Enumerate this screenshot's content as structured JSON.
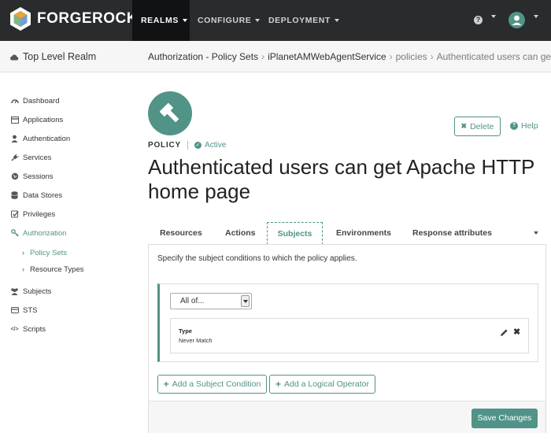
{
  "brand": {
    "name": "FORGEROCK",
    "accent": "#519387",
    "navbar_bg": "#292b2c"
  },
  "nav": {
    "items": [
      {
        "label": "REALMS",
        "active": true
      },
      {
        "label": "CONFIGURE"
      },
      {
        "label": "DEPLOYMENT"
      }
    ],
    "help_icon": "question-circle-icon",
    "help_glyph": "?",
    "user_icon": "avatar-icon"
  },
  "realm": {
    "label": "Top Level Realm",
    "icon": "cloud-icon"
  },
  "breadcrumb": {
    "items": [
      "Authorization - Policy Sets",
      "iPlanetAMWebAgentService",
      "policies",
      "Authenticated users can get Apache HTTP home page"
    ],
    "separator": "›"
  },
  "sidebar": {
    "items": [
      {
        "label": "Dashboard",
        "icon": "dashboard-icon"
      },
      {
        "label": "Applications",
        "icon": "applications-icon"
      },
      {
        "label": "Authentication",
        "icon": "user-icon"
      },
      {
        "label": "Services",
        "icon": "plug-icon"
      },
      {
        "label": "Sessions",
        "icon": "globe-icon"
      },
      {
        "label": "Data Stores",
        "icon": "database-icon"
      },
      {
        "label": "Privileges",
        "icon": "check-square-icon"
      },
      {
        "label": "Authorization",
        "icon": "key-icon",
        "active": true
      },
      {
        "label": "Subjects",
        "icon": "users-icon"
      },
      {
        "label": "STS",
        "icon": "card-icon"
      },
      {
        "label": "Scripts",
        "icon": "code-icon"
      }
    ],
    "subitems": [
      {
        "label": "Policy Sets",
        "active": true
      },
      {
        "label": "Resource Types"
      }
    ],
    "chevron": "›",
    "script_glyph": "</>"
  },
  "policy": {
    "label": "POLICY",
    "status": "Active",
    "status_glyph": "✓",
    "title": "Authenticated users can get Apache HTTP home page",
    "icon": "gavel-icon"
  },
  "actions": {
    "delete_label": "Delete",
    "delete_glyph": "✖",
    "help_label": "Help",
    "help_glyph": "?"
  },
  "tabs": [
    {
      "label": "Resources"
    },
    {
      "label": "Actions"
    },
    {
      "label": "Subjects",
      "active": true
    },
    {
      "label": "Environments"
    },
    {
      "label": "Response attributes"
    }
  ],
  "subjects_panel": {
    "description": "Specify the subject conditions to which the policy applies.",
    "operator_select": {
      "value": "All of..."
    },
    "condition": {
      "type_label": "Type",
      "type_value": "Never Match"
    },
    "remove_glyph": "✖",
    "plus_glyph": "+",
    "add_subject_label": "Add a Subject Condition",
    "add_operator_label": "Add a Logical Operator",
    "save_label": "Save Changes"
  }
}
